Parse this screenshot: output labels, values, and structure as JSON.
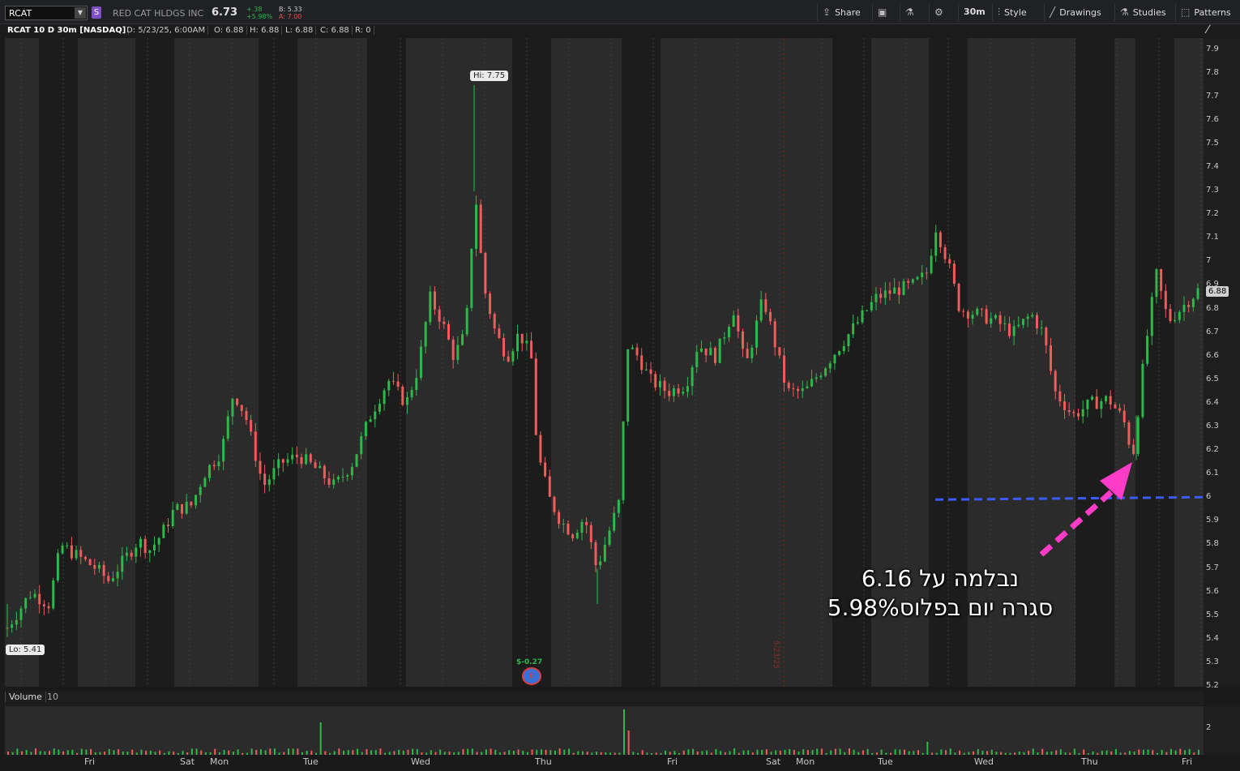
{
  "toolbar": {
    "symbol": "RCAT",
    "symbol_badge": "S",
    "company": "RED CAT HLDGS INC",
    "last": "6.73",
    "change": "+.38",
    "change_pct": "+5.98%",
    "bid": "B: 5.33",
    "ask": "A: 7.00",
    "buttons": {
      "share": "Share",
      "interval": "30m",
      "style": "Style",
      "drawings": "Drawings",
      "studies": "Studies",
      "patterns": "Patterns"
    }
  },
  "infobar": {
    "title": "RCAT 10 D 30m [NASDAQ]",
    "date": "D: 5/23/25, 6:00AM",
    "open": "O: 6.88",
    "high": "H: 6.88",
    "low": "L: 6.88",
    "close": "C: 6.88",
    "range": "R: 0"
  },
  "price_axis": {
    "ticks": [
      "7.9",
      "7.8",
      "7.7",
      "7.6",
      "7.5",
      "7.4",
      "7.3",
      "7.2",
      "7.1",
      "7",
      "6.9",
      "6.8",
      "6.7",
      "6.6",
      "6.5",
      "6.4",
      "6.3",
      "6.2",
      "6.1",
      "6",
      "5.9",
      "5.8",
      "5.7",
      "5.6",
      "5.5",
      "5.4",
      "5.3",
      "5.2"
    ],
    "last_tag": "6.88"
  },
  "time_axis": {
    "labels": [
      "Fri",
      "Sat",
      "Mon",
      "Tue",
      "Wed",
      "Thu",
      "Fri",
      "Sat",
      "Mon",
      "Tue",
      "Wed",
      "Thu",
      "Fri"
    ]
  },
  "markers": {
    "hi": "Hi: 7.75",
    "lo": "Lo: 5.41",
    "dividend": "$-0.27",
    "dividend_icon": "E",
    "split_label": "5/23/25"
  },
  "volume": {
    "label": "Volume",
    "length": "10",
    "axis_tick": "2"
  },
  "annotation": {
    "line1": "נבלמה על 6.16",
    "line2": "סגרה יום בפלוס5.98%"
  },
  "colors": {
    "up": "#2db84a",
    "down": "#f05b5b",
    "accent_arrow": "#ff3cc8",
    "support_line": "#3b5bff"
  },
  "chart_data": {
    "type": "candlestick",
    "symbol": "RCAT",
    "interval": "30m",
    "ylim": [
      5.2,
      7.95
    ],
    "hi": 7.75,
    "lo": 5.41,
    "last": 6.88,
    "support_level": 6.0,
    "bounce_low": 6.16,
    "series": [
      {
        "x": 0.0,
        "y": 5.45
      },
      {
        "x": 0.02,
        "y": 5.6
      },
      {
        "x": 0.035,
        "y": 5.55
      },
      {
        "x": 0.045,
        "y": 5.8
      },
      {
        "x": 0.06,
        "y": 5.75
      },
      {
        "x": 0.075,
        "y": 5.7
      },
      {
        "x": 0.085,
        "y": 5.65
      },
      {
        "x": 0.1,
        "y": 5.75
      },
      {
        "x": 0.11,
        "y": 5.82
      },
      {
        "x": 0.12,
        "y": 5.78
      },
      {
        "x": 0.13,
        "y": 5.85
      },
      {
        "x": 0.14,
        "y": 5.95
      },
      {
        "x": 0.155,
        "y": 5.97
      },
      {
        "x": 0.165,
        "y": 6.1
      },
      {
        "x": 0.18,
        "y": 6.2
      },
      {
        "x": 0.19,
        "y": 6.45
      },
      {
        "x": 0.2,
        "y": 6.35
      },
      {
        "x": 0.215,
        "y": 6.05
      },
      {
        "x": 0.23,
        "y": 6.15
      },
      {
        "x": 0.245,
        "y": 6.18
      },
      {
        "x": 0.26,
        "y": 6.12
      },
      {
        "x": 0.275,
        "y": 6.05
      },
      {
        "x": 0.29,
        "y": 6.15
      },
      {
        "x": 0.305,
        "y": 6.35
      },
      {
        "x": 0.32,
        "y": 6.5
      },
      {
        "x": 0.335,
        "y": 6.4
      },
      {
        "x": 0.345,
        "y": 6.55
      },
      {
        "x": 0.355,
        "y": 6.85
      },
      {
        "x": 0.365,
        "y": 6.75
      },
      {
        "x": 0.375,
        "y": 6.6
      },
      {
        "x": 0.385,
        "y": 6.7
      },
      {
        "x": 0.393,
        "y": 7.3
      },
      {
        "x": 0.4,
        "y": 6.9
      },
      {
        "x": 0.41,
        "y": 6.7
      },
      {
        "x": 0.42,
        "y": 6.6
      },
      {
        "x": 0.43,
        "y": 6.7
      },
      {
        "x": 0.44,
        "y": 6.6
      },
      {
        "x": 0.445,
        "y": 6.2
      },
      {
        "x": 0.455,
        "y": 6.0
      },
      {
        "x": 0.465,
        "y": 5.9
      },
      {
        "x": 0.475,
        "y": 5.85
      },
      {
        "x": 0.485,
        "y": 5.92
      },
      {
        "x": 0.495,
        "y": 5.7
      },
      {
        "x": 0.505,
        "y": 5.85
      },
      {
        "x": 0.515,
        "y": 6.0
      },
      {
        "x": 0.52,
        "y": 6.65
      },
      {
        "x": 0.53,
        "y": 6.6
      },
      {
        "x": 0.54,
        "y": 6.5
      },
      {
        "x": 0.555,
        "y": 6.45
      },
      {
        "x": 0.57,
        "y": 6.48
      },
      {
        "x": 0.58,
        "y": 6.65
      },
      {
        "x": 0.595,
        "y": 6.6
      },
      {
        "x": 0.61,
        "y": 6.8
      },
      {
        "x": 0.62,
        "y": 6.55
      },
      {
        "x": 0.635,
        "y": 6.85
      },
      {
        "x": 0.645,
        "y": 6.65
      },
      {
        "x": 0.655,
        "y": 6.45
      },
      {
        "x": 0.67,
        "y": 6.45
      },
      {
        "x": 0.685,
        "y": 6.55
      },
      {
        "x": 0.7,
        "y": 6.65
      },
      {
        "x": 0.715,
        "y": 6.75
      },
      {
        "x": 0.73,
        "y": 6.85
      },
      {
        "x": 0.745,
        "y": 6.88
      },
      {
        "x": 0.76,
        "y": 6.9
      },
      {
        "x": 0.772,
        "y": 6.95
      },
      {
        "x": 0.78,
        "y": 7.15
      },
      {
        "x": 0.79,
        "y": 7.0
      },
      {
        "x": 0.8,
        "y": 6.8
      },
      {
        "x": 0.815,
        "y": 6.78
      },
      {
        "x": 0.83,
        "y": 6.75
      },
      {
        "x": 0.845,
        "y": 6.7
      },
      {
        "x": 0.86,
        "y": 6.78
      },
      {
        "x": 0.87,
        "y": 6.7
      },
      {
        "x": 0.88,
        "y": 6.45
      },
      {
        "x": 0.895,
        "y": 6.35
      },
      {
        "x": 0.91,
        "y": 6.4
      },
      {
        "x": 0.925,
        "y": 6.42
      },
      {
        "x": 0.935,
        "y": 6.35
      },
      {
        "x": 0.94,
        "y": 6.3
      },
      {
        "x": 0.945,
        "y": 6.16
      },
      {
        "x": 0.955,
        "y": 6.6
      },
      {
        "x": 0.965,
        "y": 6.95
      },
      {
        "x": 0.975,
        "y": 6.75
      },
      {
        "x": 0.985,
        "y": 6.8
      },
      {
        "x": 1.0,
        "y": 6.88
      }
    ]
  }
}
